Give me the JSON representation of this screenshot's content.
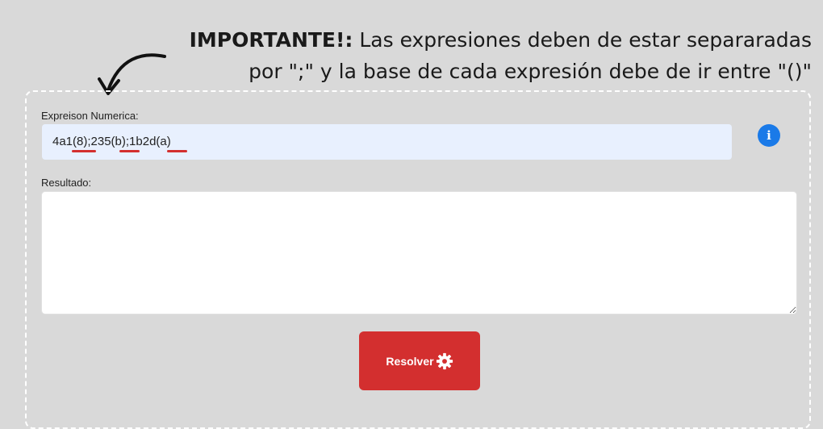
{
  "note": {
    "bold_prefix": "IMPORTANTE!:",
    "line1_rest": " Las expresiones deben de estar separaradas",
    "line2": "por \";\" y la base de cada expresión debe de ir entre \"()\""
  },
  "form": {
    "expression_label": "Expreison Numerica:",
    "expression_value": "4a1(8);235(b);1b2d(a)",
    "info_icon_glyph": "i",
    "result_label": "Resultado:",
    "result_value": "",
    "solve_button_label": "Resolver"
  },
  "icons": {
    "info": "info-icon",
    "solve": "gear-icon",
    "note": "curved-arrow-icon"
  },
  "colors": {
    "background": "#d9d9d9",
    "input_background": "#e8f0fe",
    "accent_red": "#d32f2f",
    "info_blue": "#1a7ae8"
  }
}
